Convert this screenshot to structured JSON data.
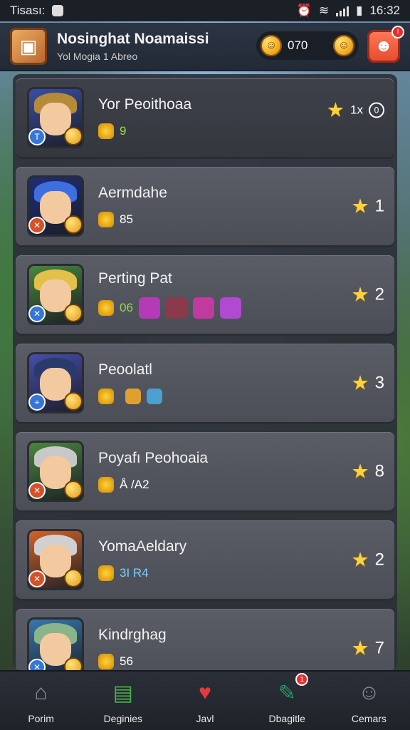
{
  "status_bar": {
    "carrier": "Tisası:",
    "time": "16:32"
  },
  "header": {
    "title": "Nosinghat Noamaissi",
    "subtitle": "Yol Mogia 1 Abreo",
    "currency_value": "070"
  },
  "players": [
    {
      "name": "Yor Peoithoaa",
      "meta_value": "9",
      "meta_color": "#9ad84a",
      "rank": "1x",
      "extra": "0",
      "avatar_bg": "#3b4fa8",
      "hair": "#b58b3a",
      "badge_l": "#3576d6",
      "badge_l_icon": "T"
    },
    {
      "name": "Aermdahe",
      "meta_value": "85",
      "meta_color": "#ffffff",
      "rank": "1",
      "avatar_bg": "#1e2f7a",
      "hair": "#3f6ee0",
      "badge_l": "#d6502a",
      "badge_l_icon": "✕"
    },
    {
      "name": "Perting Pat",
      "meta_value": "06",
      "meta_color": "#9ad84a",
      "rank": "2",
      "avatar_bg": "#4b8a3f",
      "hair": "#e2c04a",
      "badge_l": "#3576d6",
      "badge_l_icon": "✕"
    },
    {
      "name": "Peoolatl",
      "meta_value": "",
      "meta_color": "#ffffff",
      "rank": "3",
      "avatar_bg": "#4a4fb0",
      "hair": "#2a3a6a",
      "badge_l": "#3576d6",
      "badge_l_icon": "⌖"
    },
    {
      "name": "Poyafı Peohoaia",
      "meta_value": "Å /A2",
      "meta_color": "#ffffff",
      "rank": "8",
      "avatar_bg": "#4b8a3f",
      "hair": "#c8c8c8",
      "badge_l": "#d6502a",
      "badge_l_icon": "✕"
    },
    {
      "name": "YomaAeldary",
      "meta_value": "3I R4",
      "meta_color": "#7ad0ff",
      "rank": "2",
      "avatar_bg": "#d8662a",
      "hair": "#d0d0d0",
      "badge_l": "#d6502a",
      "badge_l_icon": "✕"
    },
    {
      "name": "Kindrghag",
      "meta_value": "56",
      "meta_color": "#ffffff",
      "rank": "7",
      "avatar_bg": "#3a7ab0",
      "hair": "#8ab48a",
      "badge_l": "#3576d6",
      "badge_l_icon": "✕"
    }
  ],
  "nav": [
    {
      "label": "Porim",
      "icon": "home-icon"
    },
    {
      "label": "Deginies",
      "icon": "clipboard-icon"
    },
    {
      "label": "Javl",
      "icon": "heart-icon"
    },
    {
      "label": "Dbagitle",
      "icon": "edit-icon",
      "badge": "1"
    },
    {
      "label": "Cemars",
      "icon": "chat-icon"
    }
  ]
}
